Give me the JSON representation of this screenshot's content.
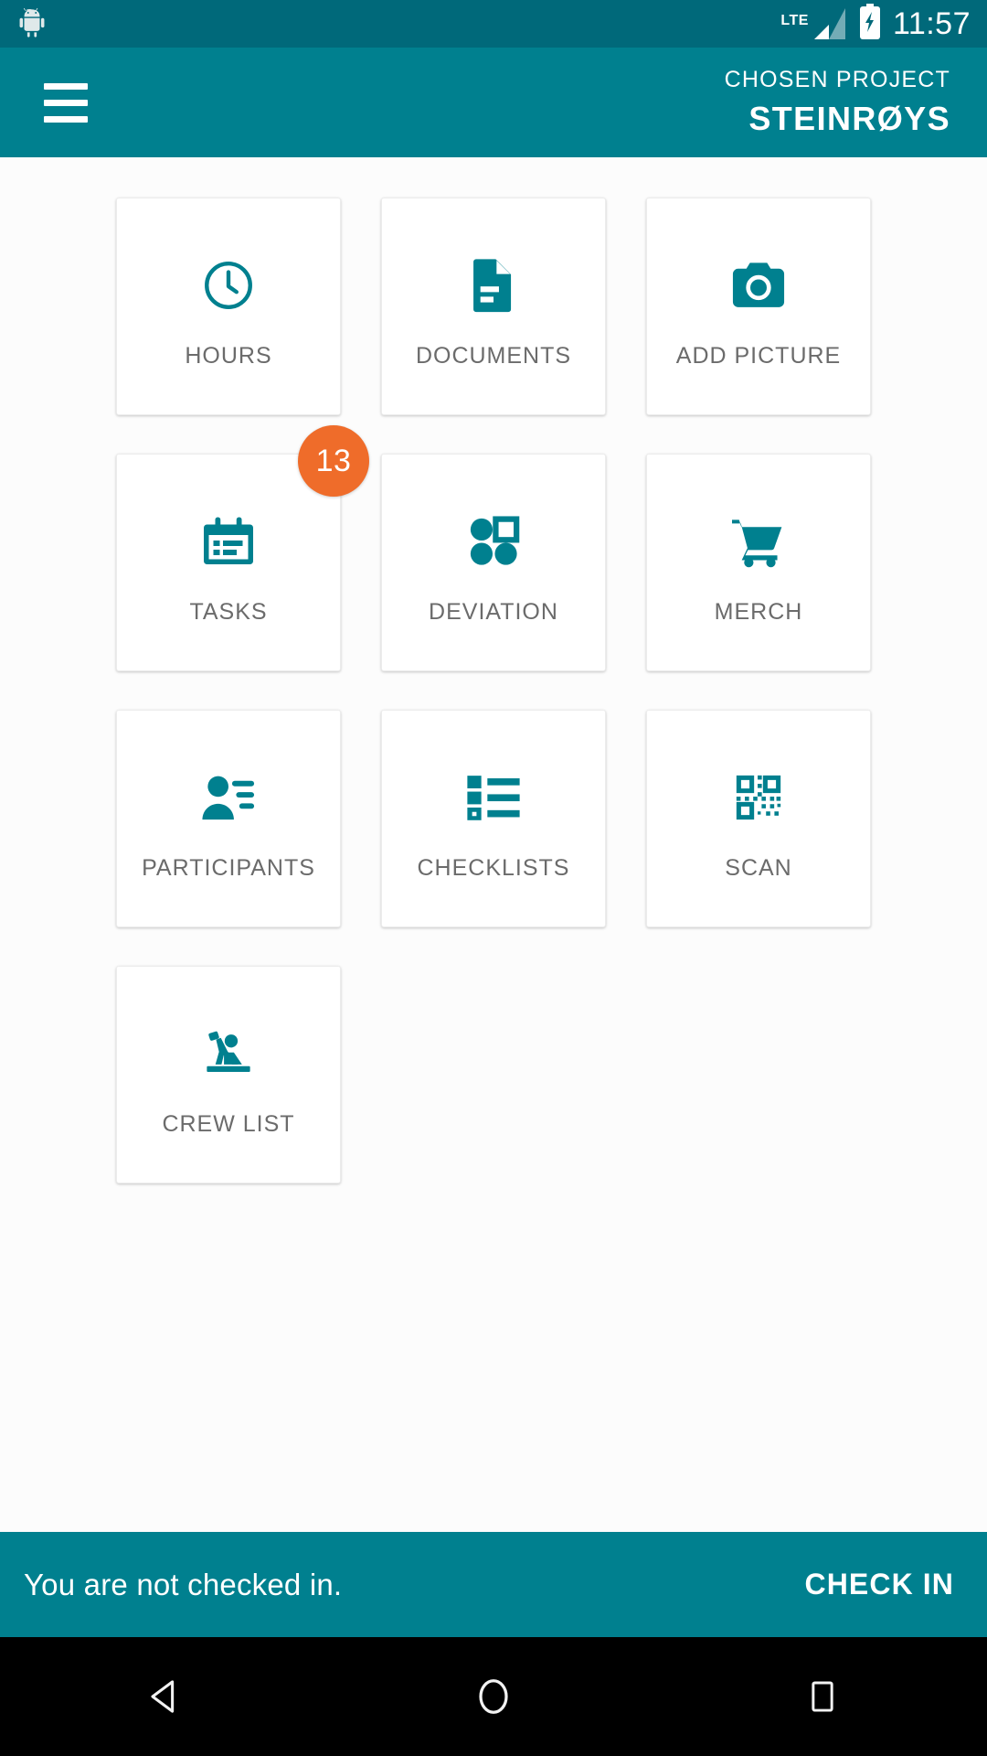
{
  "status_bar": {
    "app_icon": "android-robot-icon",
    "network_label": "LTE",
    "signal_icon": "signal-bars-icon",
    "battery_icon": "battery-charging-icon",
    "time": "11:57"
  },
  "app_bar": {
    "menu_icon": "hamburger-menu-icon",
    "subtitle": "CHOSEN PROJECT",
    "title": "STEINRØYS",
    "background_color": "#00808f"
  },
  "grid": {
    "tiles": [
      {
        "label": "HOURS",
        "icon": "clock-icon",
        "badge": null
      },
      {
        "label": "DOCUMENTS",
        "icon": "document-icon",
        "badge": null
      },
      {
        "label": "ADD PICTURE",
        "icon": "camera-icon",
        "badge": null
      },
      {
        "label": "TASKS",
        "icon": "calendar-icon",
        "badge": "13"
      },
      {
        "label": "DEVIATION",
        "icon": "shapes-icon",
        "badge": null
      },
      {
        "label": "MERCH",
        "icon": "shopping-cart-icon",
        "badge": null
      },
      {
        "label": "PARTICIPANTS",
        "icon": "person-list-icon",
        "badge": null
      },
      {
        "label": "CHECKLISTS",
        "icon": "checklist-icon",
        "badge": null
      },
      {
        "label": "SCAN",
        "icon": "qr-code-icon",
        "badge": null
      },
      {
        "label": "CREW LIST",
        "icon": "worker-icon",
        "badge": null
      }
    ],
    "icon_color": "#00808f",
    "label_color": "#6b6b6b",
    "badge_color": "#ef6c2a"
  },
  "check_in_bar": {
    "status_text": "You are not checked in.",
    "button_label": "CHECK IN"
  },
  "nav_bar": {
    "back_icon": "back-triangle-icon",
    "home_icon": "home-circle-icon",
    "recents_icon": "recents-square-icon"
  }
}
